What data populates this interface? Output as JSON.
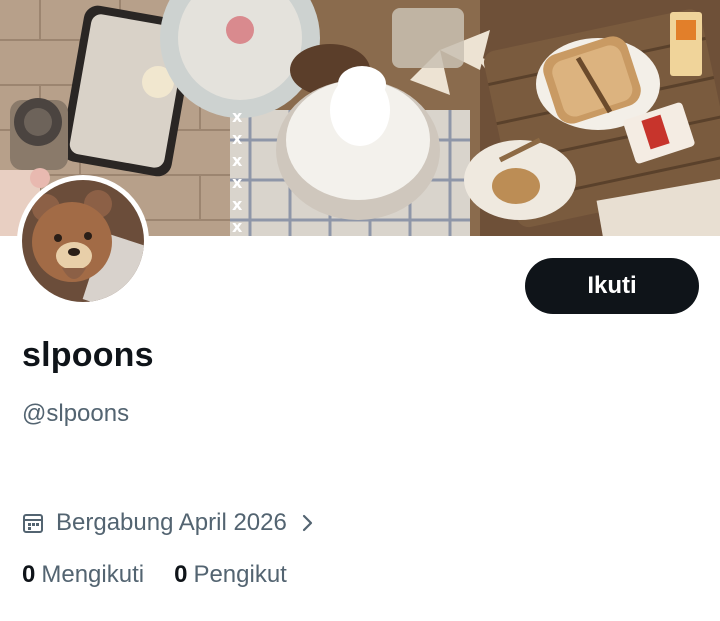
{
  "profile": {
    "display_name": "slpoons",
    "handle": "@slpoons",
    "joined": "Bergabung April 2026",
    "follow_label": "Ikuti"
  },
  "stats": {
    "following_count": "0",
    "following_label": "Mengikuti",
    "followers_count": "0",
    "followers_label": "Pengikut"
  },
  "icons": {
    "calendar": "calendar-icon",
    "chevron": "chevron-right-icon"
  },
  "colors": {
    "primary_text": "#0f1419",
    "secondary_text": "#536471",
    "button_bg": "#0f1419",
    "button_text": "#ffffff"
  }
}
